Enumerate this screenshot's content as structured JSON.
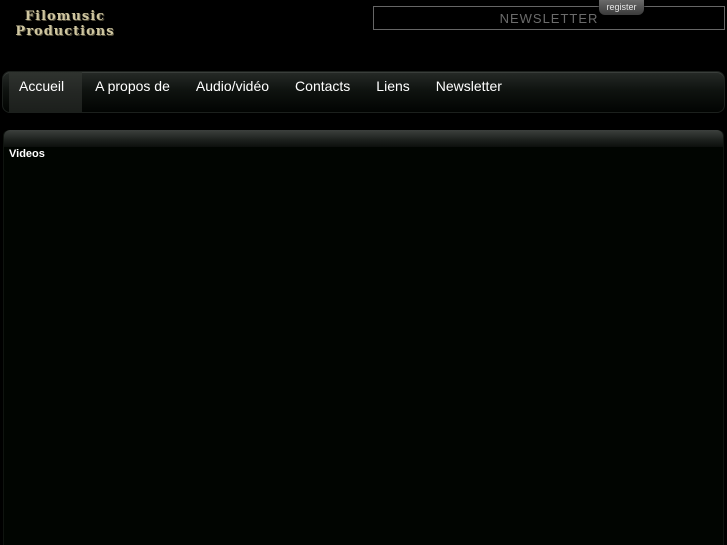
{
  "logo": {
    "line1": "Filomusic",
    "line2": "Productions"
  },
  "newsletter": {
    "placeholder": "NEWSLETTER",
    "value": ""
  },
  "register": {
    "label": "register"
  },
  "nav": {
    "items": [
      {
        "label": "Accueil",
        "active": true
      },
      {
        "label": "A propos de"
      },
      {
        "label": "Audio/vidéo"
      },
      {
        "label": "Contacts"
      },
      {
        "label": "Liens"
      },
      {
        "label": "Newsletter"
      }
    ]
  },
  "panel": {
    "title": "Videos"
  },
  "colors": {
    "background": "#000000",
    "logo": "#cfc6a0",
    "nav_text": "#ffffff",
    "placeholder": "#6b6b6b"
  }
}
